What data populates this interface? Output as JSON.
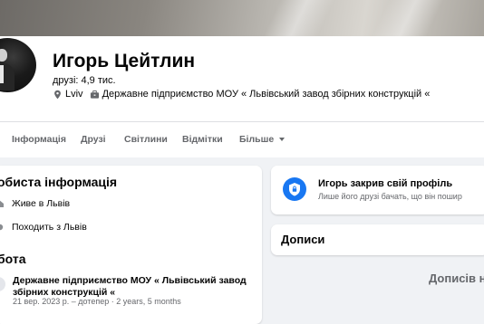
{
  "profile": {
    "name": "Игорь Цейтлин",
    "friends": "друзі: 4,9 тис.",
    "location": "Lviv",
    "workplace": "Державне підприємство МОУ « Львівський завод збірних конструкцій «"
  },
  "tabs": [
    "Інформація",
    "Друзі",
    "Світлини",
    "Відмітки",
    "Більше"
  ],
  "about": {
    "title": "обиста інформація",
    "lives": "Живе в Львів",
    "from": "Походить з Львів"
  },
  "work": {
    "title": "бота",
    "company": "Державне підприємство МОУ « Львівський завод збірних конструкцій «",
    "dates": "21 вер. 2023 р. – дотепер · 2 years, 5 months"
  },
  "privacy": {
    "title": "Игорь закрив свій профіль",
    "subtitle": "Лише його друзі бачать, що він пошир"
  },
  "posts": {
    "title": "Дописи",
    "empty": "Дописів н"
  },
  "colors": {
    "accent": "#1877f2",
    "muted_text": "#65676b",
    "background": "#f0f2f5"
  },
  "icons": {
    "location": "location-pin-icon",
    "work": "briefcase-icon",
    "lock": "shield-lock-icon",
    "more": "chevron-down-icon"
  }
}
